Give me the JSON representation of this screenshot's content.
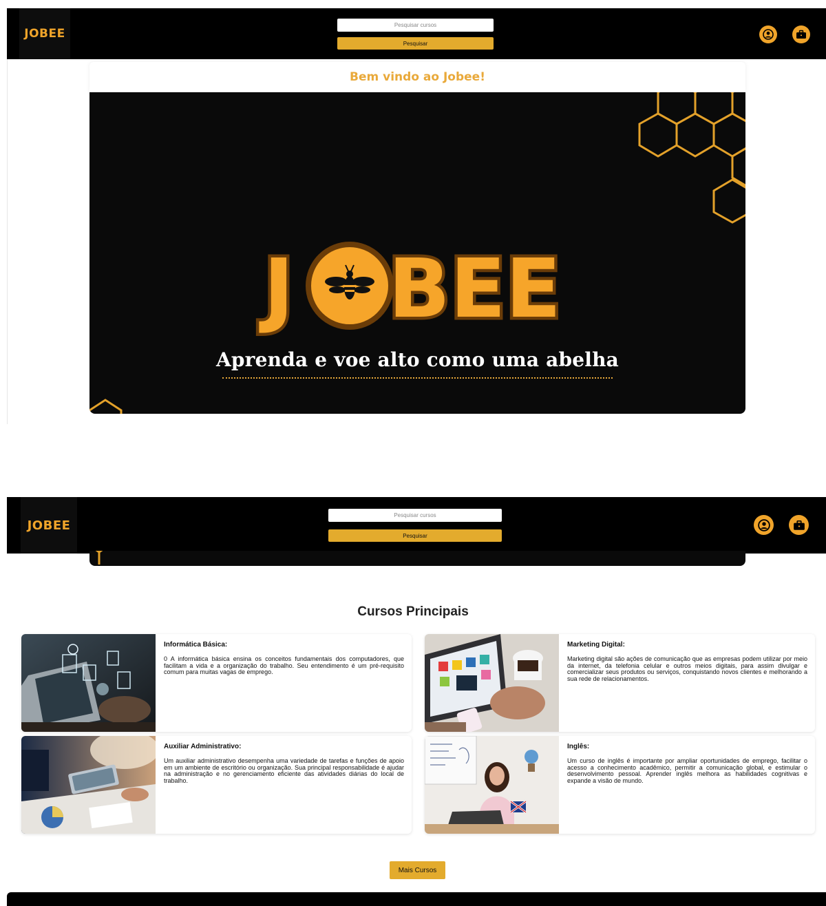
{
  "header": {
    "logo": "JOBEE",
    "search_placeholder": "Pesquisar cursos",
    "search_button": "Pesquisar",
    "icons": [
      "user-icon",
      "briefcase-icon"
    ]
  },
  "welcome": {
    "title": "Bem vindo ao Jobee!"
  },
  "hero": {
    "logo_text": "JOBEE",
    "tagline": "Aprenda e voe alto como uma abelha"
  },
  "courses": {
    "section_title": "Cursos Principais",
    "items": [
      {
        "title": "Informática Básica:",
        "description": "0 A informática básica ensina os conceitos fundamentais dos computadores, que facilitam a vida e a organização do trabalho. Seu entendimento é um pré-requisito comum para muitas vagas de emprego."
      },
      {
        "title": "Marketing Digital:",
        "description": "Marketing digital são ações de comunicação que as empresas podem utilizar por meio da internet, da telefonia celular e outros meios digitais, para assim divulgar e comercializar seus produtos ou serviços, conquistando novos clientes e melhorando a sua rede de relacionamentos."
      },
      {
        "title": "Auxiliar Administrativo:",
        "description": "Um auxiliar administrativo desempenha uma variedade de tarefas e funções de apoio em um ambiente de escritório ou organização. Sua principal responsabilidade é ajudar na administração e no gerenciamento eficiente das atividades diárias do local de trabalho."
      },
      {
        "title": "Inglês:",
        "description": "Um curso de inglês é importante por ampliar oportunidades de emprego, facilitar o acesso a conhecimento acadêmico, permitir a comunicação global, e estimular o desenvolvimento pessoal. Aprender inglês melhora as habilidades cognitivas e expande a visão de mundo."
      }
    ],
    "more_button": "Mais Cursos"
  },
  "colors": {
    "accent": "#e3ab2d",
    "logo": "#f0a42a",
    "header_bg": "#000000"
  }
}
